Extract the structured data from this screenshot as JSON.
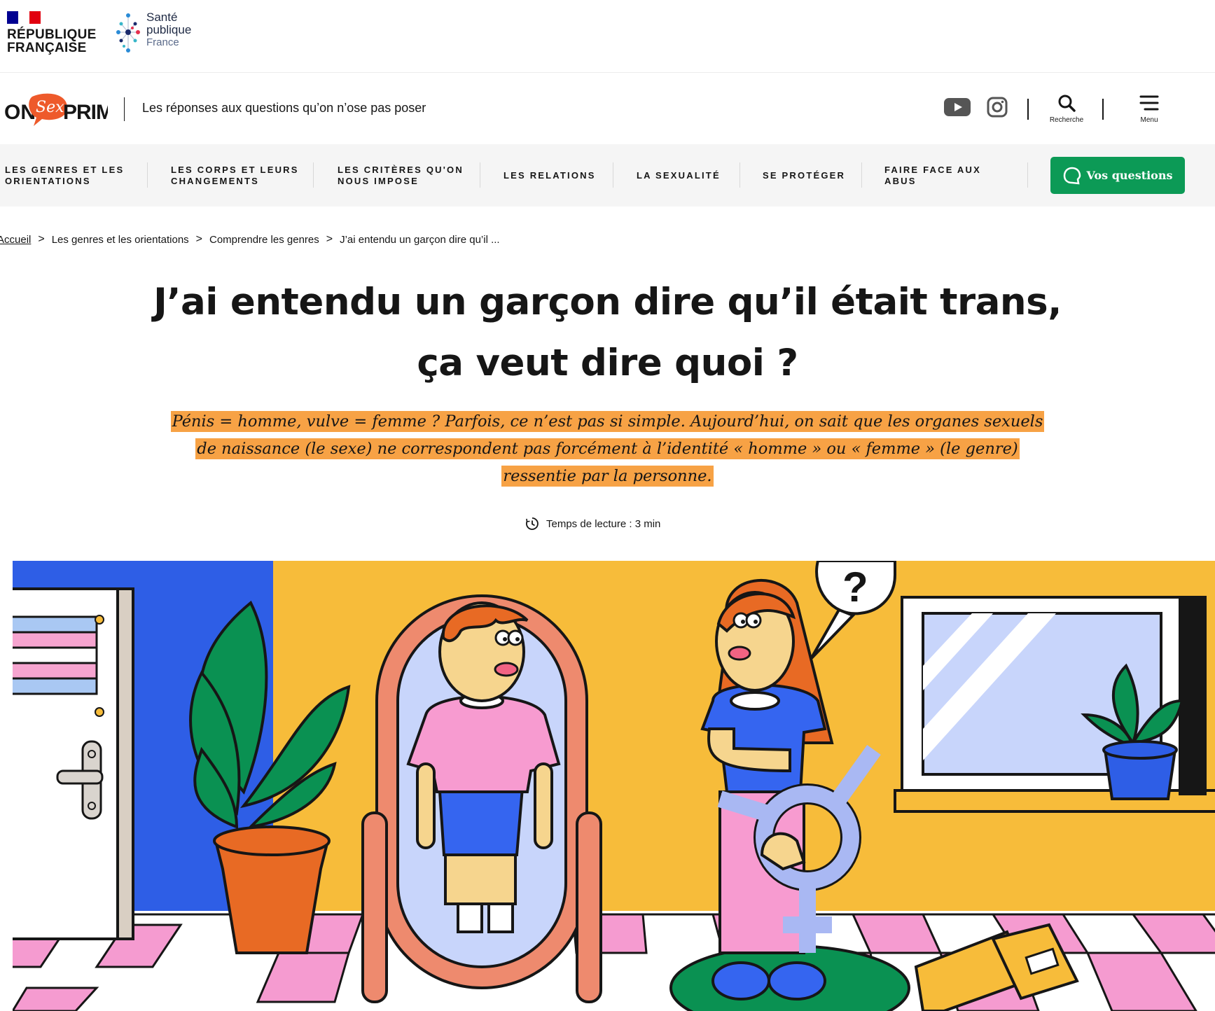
{
  "gov": {
    "republique": "RÉPUBLIQUE\nFRANÇAISE",
    "spf_line1": "Santé",
    "spf_line2": "publique",
    "spf_line3": "France",
    "flag_colors": [
      "#000091",
      "#ffffff",
      "#e1000f"
    ]
  },
  "header": {
    "logo_on": "ON",
    "logo_sex": "Sex",
    "logo_prime": "PRIME",
    "tagline": "Les réponses aux questions qu’on n’ose pas poser",
    "youtube_icon": "youtube-icon",
    "instagram_icon": "instagram-icon",
    "search_label": "Recherche",
    "menu_label": "Menu"
  },
  "nav": {
    "items": [
      "Les genres et les orientations",
      "Les corps et leurs changements",
      "Les critères qu'on nous impose",
      "Les relations",
      "La sexualité",
      "Se protéger",
      "Faire face aux abus"
    ],
    "cta": "Vos questions",
    "cta_color": "#0c9a56"
  },
  "breadcrumb": {
    "items": [
      "Accueil",
      "Les genres et les orientations",
      "Comprendre les genres",
      "J’ai entendu un garçon dire qu’il ..."
    ],
    "separator": ">"
  },
  "article": {
    "title_line1": "J’ai entendu un garçon dire qu’il était trans,",
    "title_line2": "ça veut dire quoi ?",
    "chapo_line1": "Pénis = homme, vulve = femme ? Parfois, ce n’est pas si simple. Aujourd’hui, on sait que les organes sexuels",
    "chapo_line2": "de naissance (le sexe) ne correspondent pas forcément à l’identité « homme » ou « femme » (le genre)",
    "chapo_line3": "ressentie par la personne.",
    "highlight_color": "#f7a245",
    "reading_time": "Temps de lecture : 3 min"
  },
  "illustration": {
    "question_mark": "?"
  }
}
